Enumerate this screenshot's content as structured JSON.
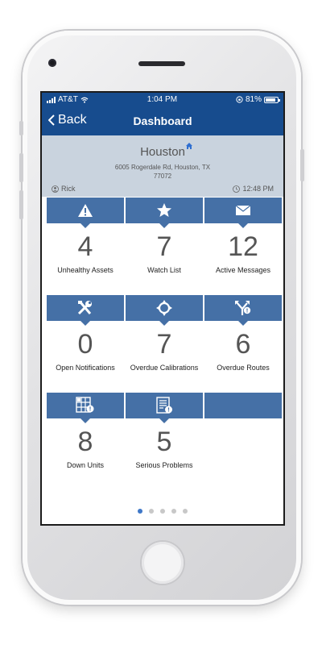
{
  "status_bar": {
    "carrier": "AT&T",
    "time": "1:04 PM",
    "battery": "81%",
    "icons": [
      "signal-icon",
      "wifi-icon",
      "lock-rotation-icon",
      "battery-icon"
    ]
  },
  "nav": {
    "back_label": "Back",
    "title": "Dashboard"
  },
  "location": {
    "city": "Houston",
    "address_line1": "6005 Rogerdale Rd, Houston, TX",
    "address_line2": "77072",
    "user": "Rick",
    "time": "12:48 PM",
    "icons": [
      "house-icon",
      "user-icon",
      "clock-icon"
    ]
  },
  "tiles": [
    {
      "icon": "warning-icon",
      "value": "4",
      "label": "Unhealthy Assets"
    },
    {
      "icon": "star-icon",
      "value": "7",
      "label": "Watch List"
    },
    {
      "icon": "envelope-icon",
      "value": "12",
      "label": "Active Messages"
    },
    {
      "icon": "tools-icon",
      "value": "0",
      "label": "Open Notifications"
    },
    {
      "icon": "crosshair-icon",
      "value": "7",
      "label": "Overdue Calibrations"
    },
    {
      "icon": "route-fork-icon",
      "value": "6",
      "label": "Overdue Routes"
    },
    {
      "icon": "unit-grid-icon",
      "value": "8",
      "label": "Down Units"
    },
    {
      "icon": "document-alert-icon",
      "value": "5",
      "label": "Serious Problems"
    },
    {
      "icon": "",
      "value": "",
      "label": ""
    }
  ],
  "pager": {
    "count": 5,
    "active": 1
  },
  "colors": {
    "nav_blue": "#174c8e",
    "tile_blue": "#4570a6",
    "location_bg": "#c9d3de",
    "active_dot": "#3f78c8"
  }
}
